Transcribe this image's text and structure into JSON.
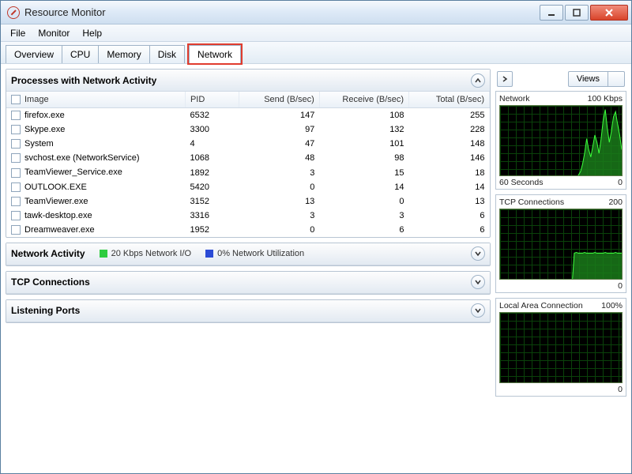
{
  "window": {
    "title": "Resource Monitor"
  },
  "menu": {
    "file": "File",
    "monitor": "Monitor",
    "help": "Help"
  },
  "tabs": {
    "overview": "Overview",
    "cpu": "CPU",
    "memory": "Memory",
    "disk": "Disk",
    "network": "Network",
    "active": "network"
  },
  "panels": {
    "processes": {
      "title": "Processes with Network Activity",
      "columns": {
        "image": "Image",
        "pid": "PID",
        "send": "Send (B/sec)",
        "receive": "Receive (B/sec)",
        "total": "Total (B/sec)"
      },
      "rows": [
        {
          "image": "firefox.exe",
          "pid": "6532",
          "send": "147",
          "receive": "108",
          "total": "255"
        },
        {
          "image": "Skype.exe",
          "pid": "3300",
          "send": "97",
          "receive": "132",
          "total": "228"
        },
        {
          "image": "System",
          "pid": "4",
          "send": "47",
          "receive": "101",
          "total": "148"
        },
        {
          "image": "svchost.exe (NetworkService)",
          "pid": "1068",
          "send": "48",
          "receive": "98",
          "total": "146"
        },
        {
          "image": "TeamViewer_Service.exe",
          "pid": "1892",
          "send": "3",
          "receive": "15",
          "total": "18"
        },
        {
          "image": "OUTLOOK.EXE",
          "pid": "5420",
          "send": "0",
          "receive": "14",
          "total": "14"
        },
        {
          "image": "TeamViewer.exe",
          "pid": "3152",
          "send": "13",
          "receive": "0",
          "total": "13"
        },
        {
          "image": "tawk-desktop.exe",
          "pid": "3316",
          "send": "3",
          "receive": "3",
          "total": "6"
        },
        {
          "image": "Dreamweaver.exe",
          "pid": "1952",
          "send": "0",
          "receive": "6",
          "total": "6"
        }
      ]
    },
    "activity": {
      "title": "Network Activity",
      "io_label": "20 Kbps Network I/O",
      "util_label": "0% Network Utilization"
    },
    "tcp": {
      "title": "TCP Connections"
    },
    "listening": {
      "title": "Listening Ports"
    }
  },
  "right": {
    "views_label": "Views",
    "graphs": [
      {
        "title": "Network",
        "right_top": "100 Kbps",
        "left_bottom": "60 Seconds",
        "right_bottom": "0",
        "shape": "mountain"
      },
      {
        "title": "TCP Connections",
        "right_top": "200",
        "left_bottom": "",
        "right_bottom": "0",
        "shape": "plateau"
      },
      {
        "title": "Local Area Connection",
        "right_top": "100%",
        "left_bottom": "",
        "right_bottom": "0",
        "shape": "flat"
      }
    ]
  },
  "chart_data": [
    {
      "type": "area",
      "title": "Network",
      "ylabel": "Kbps",
      "xlabel": "Seconds",
      "ylim": [
        0,
        100
      ],
      "x_range_seconds": 60,
      "values": [
        0,
        0,
        0,
        0,
        0,
        0,
        0,
        0,
        0,
        0,
        0,
        0,
        0,
        0,
        0,
        0,
        0,
        0,
        0,
        0,
        0,
        0,
        0,
        0,
        0,
        0,
        0,
        0,
        0,
        0,
        0,
        0,
        0,
        0,
        0,
        0,
        0,
        2,
        5,
        10,
        20,
        35,
        55,
        40,
        30,
        45,
        60,
        50,
        35,
        55,
        80,
        95,
        70,
        50,
        65,
        85,
        92,
        75,
        60,
        40
      ]
    },
    {
      "type": "area",
      "title": "TCP Connections",
      "ylabel": "Connections",
      "ylim": [
        0,
        200
      ],
      "x_range_seconds": 60,
      "values": [
        0,
        0,
        0,
        0,
        0,
        0,
        0,
        0,
        0,
        0,
        0,
        0,
        0,
        0,
        0,
        0,
        0,
        0,
        0,
        0,
        0,
        0,
        0,
        0,
        0,
        0,
        0,
        0,
        0,
        0,
        0,
        0,
        0,
        0,
        0,
        0,
        80,
        82,
        80,
        80,
        80,
        82,
        80,
        80,
        80,
        80,
        82,
        80,
        80,
        80,
        80,
        82,
        80,
        80,
        80,
        80,
        82,
        80,
        80,
        80
      ]
    },
    {
      "type": "area",
      "title": "Local Area Connection",
      "ylabel": "Utilization %",
      "ylim": [
        0,
        100
      ],
      "x_range_seconds": 60,
      "values": [
        0,
        0,
        0,
        0,
        0,
        0,
        0,
        0,
        0,
        0,
        0,
        0,
        0,
        0,
        0,
        0,
        0,
        0,
        0,
        0,
        0,
        0,
        0,
        0,
        0,
        0,
        0,
        0,
        0,
        0,
        0,
        0,
        0,
        0,
        0,
        0,
        0,
        0,
        0,
        0,
        0,
        0,
        0,
        0,
        0,
        0,
        0,
        0,
        0,
        0,
        0,
        0,
        0,
        0,
        0,
        0,
        0,
        0,
        0,
        0
      ]
    }
  ]
}
